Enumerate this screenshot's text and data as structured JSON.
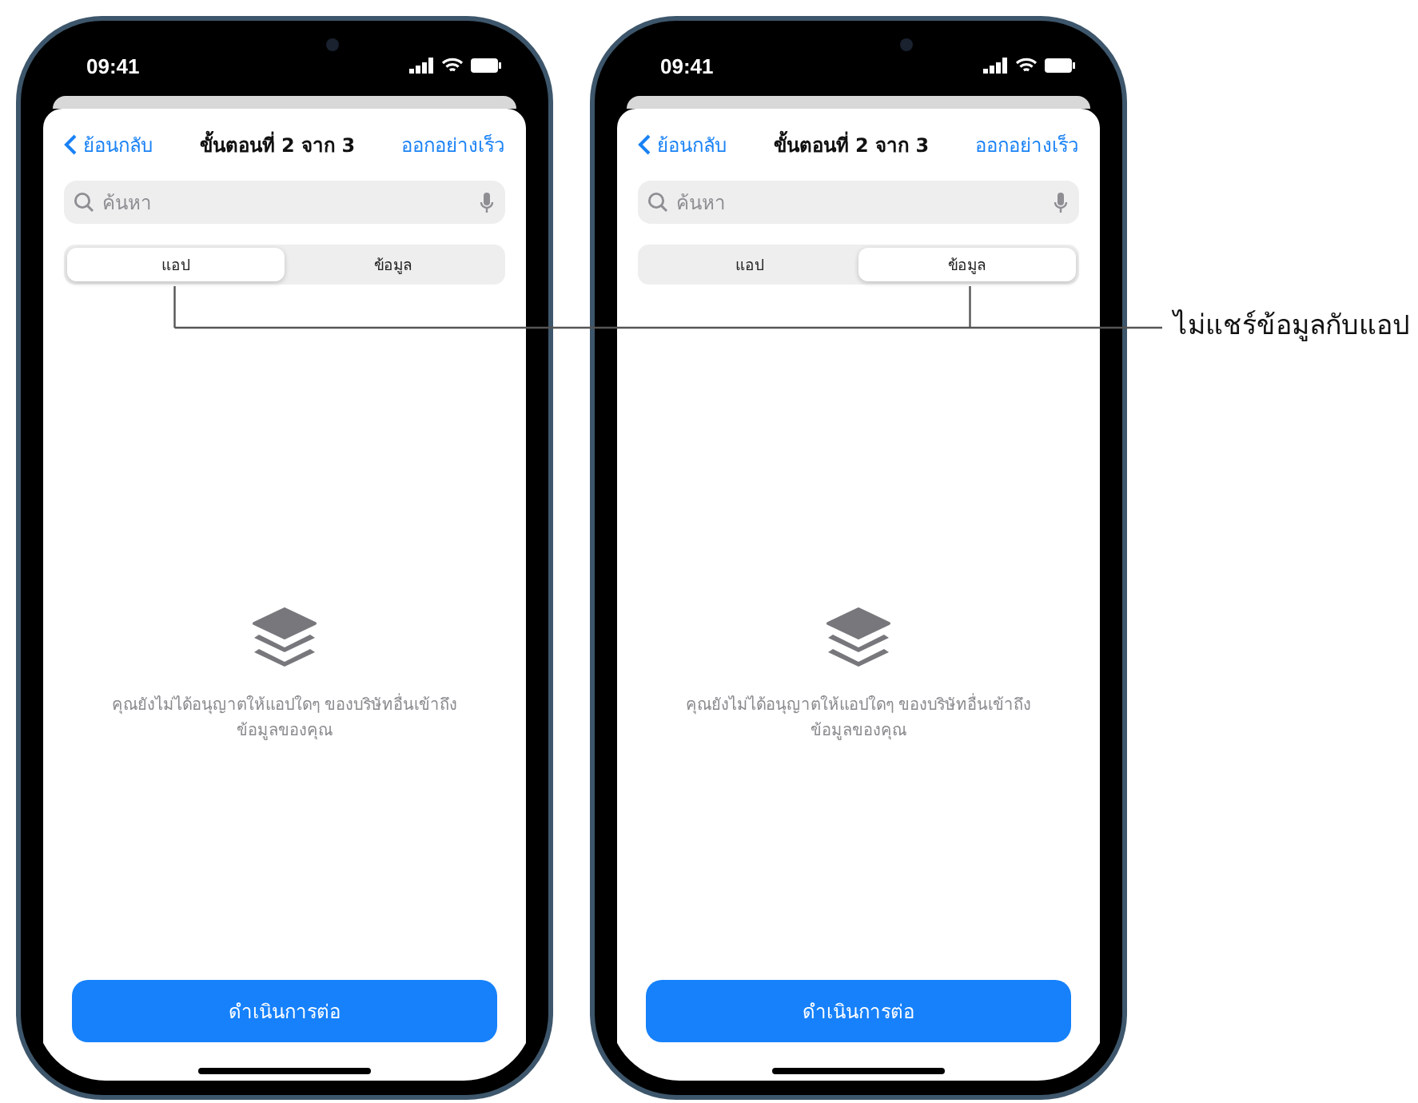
{
  "phones": [
    {
      "status": {
        "time": "09:41"
      },
      "nav": {
        "back": "ย้อนกลับ",
        "title": "ขั้นตอนที่ 2 จาก 3",
        "action": "ออกอย่างเร็ว"
      },
      "search": {
        "placeholder": "ค้นหา"
      },
      "segments": [
        {
          "label": "แอป",
          "selected": true
        },
        {
          "label": "ข้อมูล",
          "selected": false
        }
      ],
      "empty_message": "คุณยังไม่ได้อนุญาตให้แอปใดๆ ของบริษัทอื่นเข้าถึงข้อมูลของคุณ",
      "button": "ดำเนินการต่อ"
    },
    {
      "status": {
        "time": "09:41"
      },
      "nav": {
        "back": "ย้อนกลับ",
        "title": "ขั้นตอนที่ 2 จาก 3",
        "action": "ออกอย่างเร็ว"
      },
      "search": {
        "placeholder": "ค้นหา"
      },
      "segments": [
        {
          "label": "แอป",
          "selected": false
        },
        {
          "label": "ข้อมูล",
          "selected": true
        }
      ],
      "empty_message": "คุณยังไม่ได้อนุญาตให้แอปใดๆ ของบริษัทอื่นเข้าถึงข้อมูลของคุณ",
      "button": "ดำเนินการต่อ"
    }
  ],
  "callout": "ไม่แชร์ข้อมูลกับแอป"
}
